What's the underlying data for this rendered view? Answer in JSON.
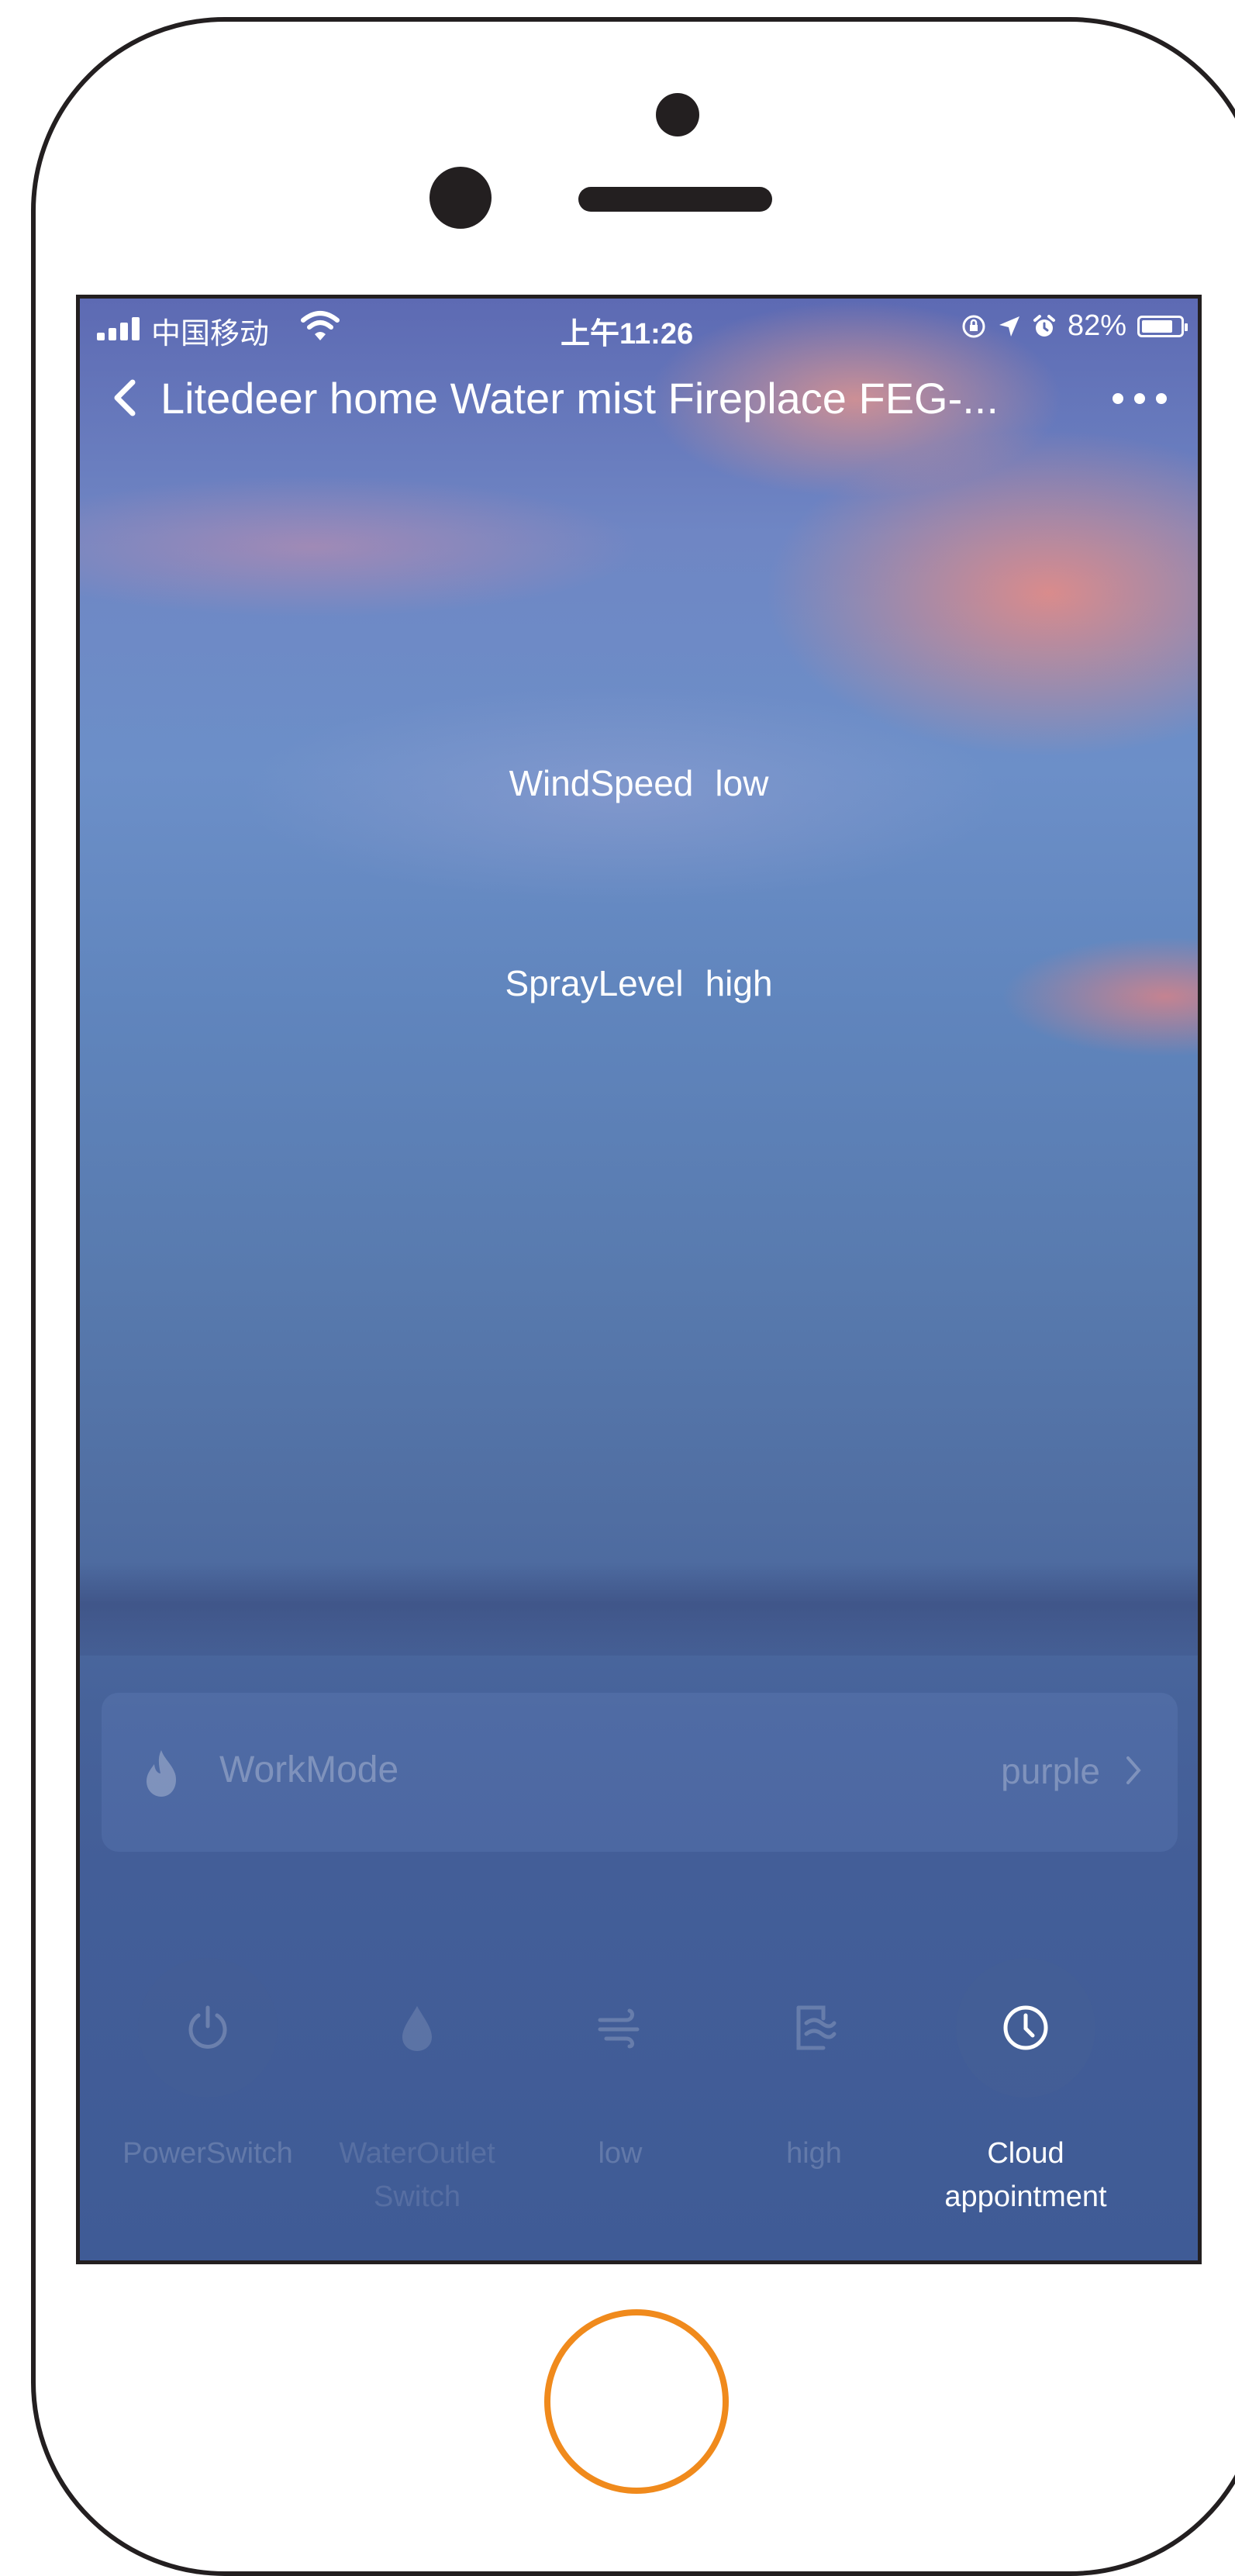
{
  "status_bar": {
    "carrier": "中国移动",
    "time": "上午11:26",
    "battery": "82%",
    "battery_level": 0.82,
    "icons": [
      "signal-icon",
      "wifi-icon",
      "orientation-lock-icon",
      "location-arrow-icon",
      "alarm-icon",
      "battery-icon"
    ]
  },
  "nav": {
    "title": "Litedeer home Water mist Fireplace FEG-..."
  },
  "info": {
    "wind_label": "WindSpeed",
    "wind_value": "low",
    "spray_label": "SprayLevel",
    "spray_value": "high"
  },
  "workmode": {
    "label": "WorkMode",
    "value": "purple",
    "icon": "flame-icon"
  },
  "actions": [
    {
      "label": "PowerSwitch",
      "icon": "power-icon",
      "enabled": false
    },
    {
      "label": "WaterOutletSwitch",
      "icon": "water-drop-icon",
      "enabled": false
    },
    {
      "label": "low",
      "icon": "wind-icon",
      "enabled": false
    },
    {
      "label": "high",
      "icon": "spray-icon",
      "enabled": false
    },
    {
      "label": "Cloud appointment",
      "icon": "clock-icon",
      "enabled": true
    }
  ],
  "colors": {
    "accent": "#f08a1c",
    "frame": "#231f20"
  }
}
